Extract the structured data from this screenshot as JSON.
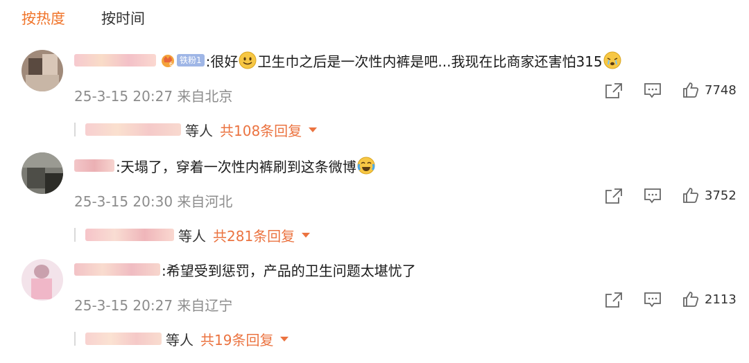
{
  "tabs": [
    {
      "label": "按热度",
      "active": true
    },
    {
      "label": "按时间",
      "active": false
    }
  ],
  "badge": "铁粉1",
  "comments": [
    {
      "text_before": ":很好",
      "text_after": "卫生巾之后是一次性内裤是吧...我现在比商家还害怕315",
      "time": "25-3-15 20:27 来自北京",
      "likes": "7748",
      "dengren": "等人",
      "reply_count": "共108条回复"
    },
    {
      "text_before": ":天塌了，穿着一次性内裤刷到这条微博",
      "text_after": "",
      "time": "25-3-15 20:30 来自河北",
      "likes": "3752",
      "dengren": "等人",
      "reply_count": "共281条回复"
    },
    {
      "text_before": ":希望受到惩罚，产品的卫生问题太堪忧了",
      "text_after": "",
      "time": "25-3-15 20:27 来自辽宁",
      "likes": "2113",
      "dengren": "等人",
      "reply_count": "共19条回复"
    }
  ],
  "colors": {
    "accent": "#f0742a",
    "reply": "#eb7340",
    "meta": "#8c8c8c",
    "badge": "#9fb6e6"
  },
  "icons": [
    "share-icon",
    "comment-icon",
    "like-icon",
    "caret-down-icon",
    "smile-emoji-icon",
    "cry-emoji-icon",
    "laugh-cry-emoji-icon"
  ]
}
